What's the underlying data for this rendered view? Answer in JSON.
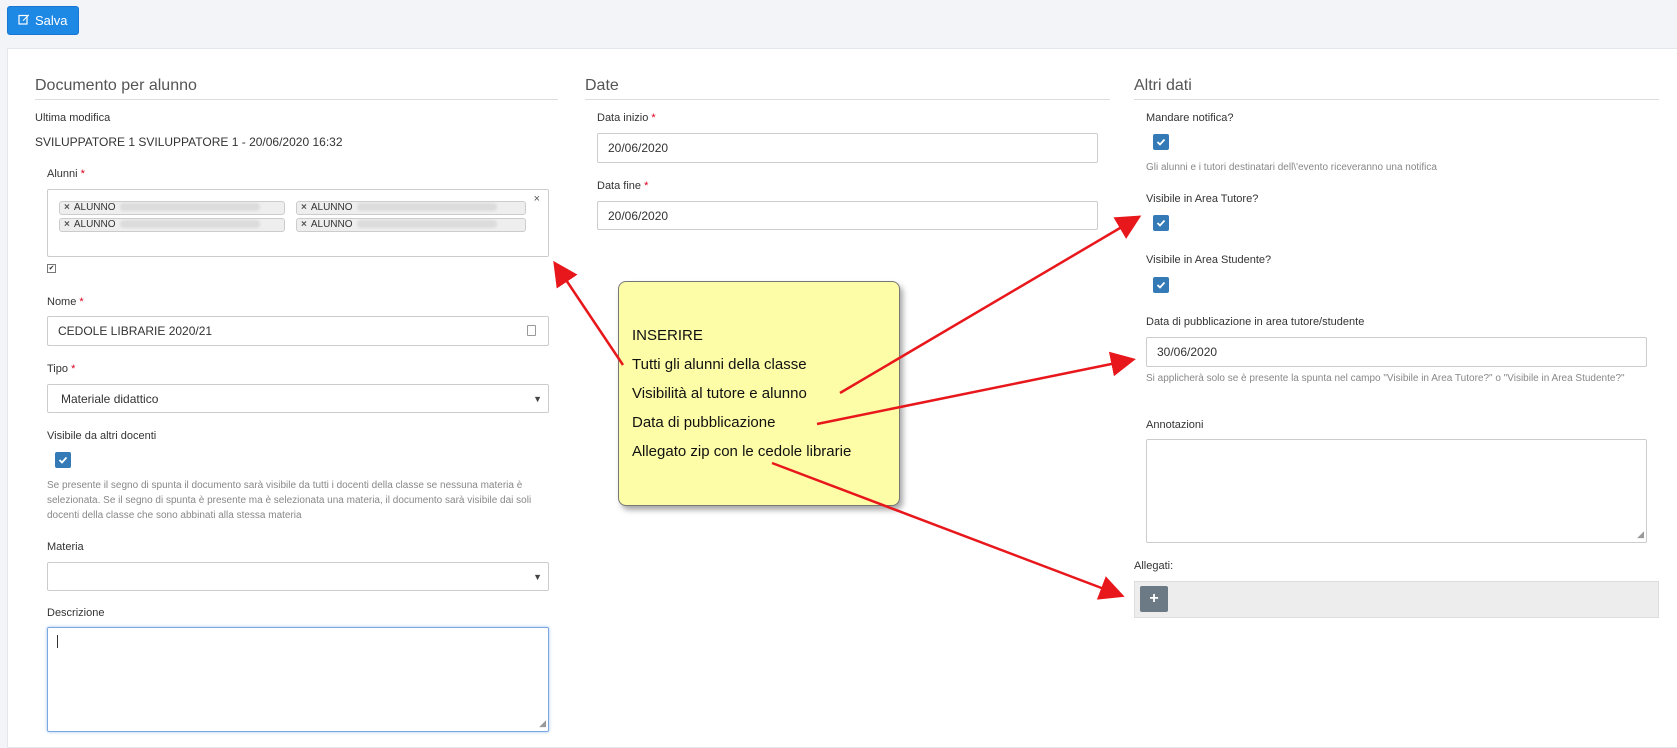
{
  "toolbar": {
    "save_label": "Salva"
  },
  "section_left": {
    "title": "Documento per alunno",
    "last_modified_label": "Ultima modifica",
    "last_modified_value": "SVILUPPATORE 1 SVILUPPATORE 1 - 20/06/2020 16:32",
    "students_label": "Alunni",
    "students_tags": [
      "ALUNNO",
      "ALUNNO",
      "ALUNNO",
      "ALUNNO"
    ],
    "clear_symbol": "×",
    "tag_remove_symbol": "×",
    "name_label": "Nome",
    "name_value": "CEDOLE LIBRARIE 2020/21",
    "type_label": "Tipo",
    "type_value": "Materiale didattico",
    "visible_label": "Visibile da altri docenti",
    "visible_help": "Se presente il segno di spunta il documento sarà visibile da tutti i docenti della classe se nessuna materia è selezionata. Se il segno di spunta è presente ma è selezionata una materia, il documento sarà visibile dai soli docenti della classe che sono abbinati alla stessa materia",
    "subject_label": "Materia",
    "subject_value": "",
    "description_label": "Descrizione",
    "required_mark": "*"
  },
  "section_middle": {
    "title": "Date",
    "start_label": "Data inizio",
    "start_value": "20/06/2020",
    "end_label": "Data fine",
    "end_value": "20/06/2020",
    "required_mark": "*"
  },
  "section_right": {
    "title": "Altri dati",
    "notify_label": "Mandare notifica?",
    "notify_help": "Gli alunni e i tutori destinatari dell\\'evento riceveranno una notifica",
    "tutor_label": "Visibile in Area Tutore?",
    "student_label": "Visibile in Area Studente?",
    "pub_label": "Data di pubblicazione in area tutore/studente",
    "pub_value": "30/06/2020",
    "pub_help": "Si applicherà solo se è presente la spunta nel campo \"Visibile in Area Tutore?\" o \"Visibile in Area Studente?\"",
    "notes_label": "Annotazioni",
    "attachments_label": "Allegati:",
    "add_symbol": "+"
  },
  "annotation": {
    "lines": [
      "INSERIRE",
      "Tutti gli alunni della classe",
      "Visibilità al tutore e alunno",
      "Data di pubblicazione",
      "Allegato zip con le cedole librarie"
    ]
  },
  "colors": {
    "accent": "#1e88e5",
    "checkbox": "#337ab7",
    "required": "#d9001b",
    "note_bg": "#fdfda7",
    "arrow": "#e8171c"
  },
  "icons": {
    "save": "edit-icon",
    "check": "check-icon",
    "dropdown": "caret-down-icon",
    "add": "plus-icon"
  }
}
